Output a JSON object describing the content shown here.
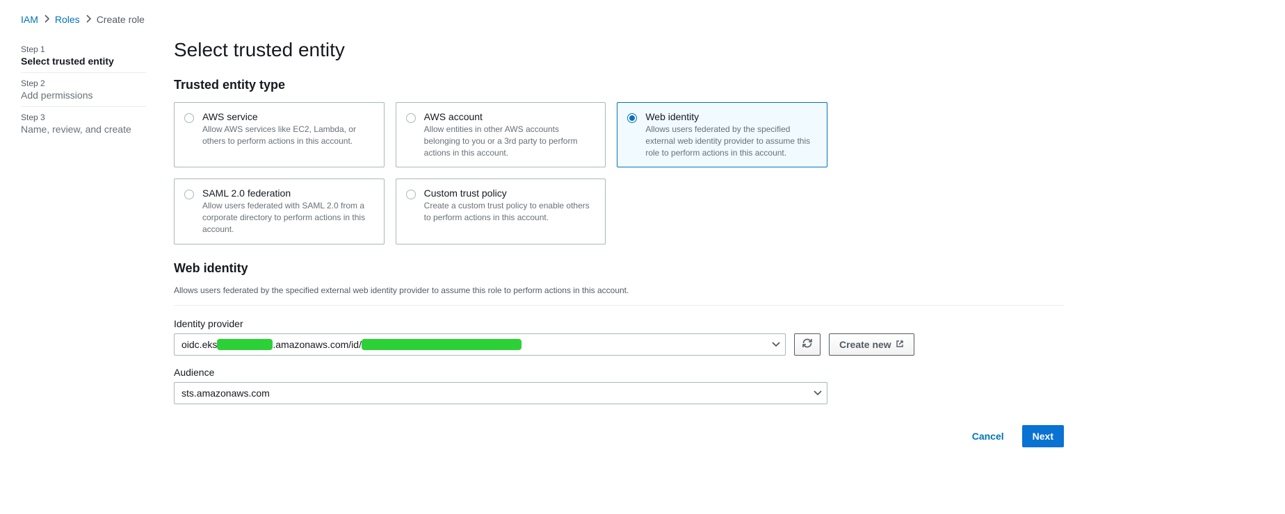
{
  "breadcrumb": {
    "iam": "IAM",
    "roles": "Roles",
    "current": "Create role"
  },
  "steps": [
    {
      "num": "Step 1",
      "title": "Select trusted entity"
    },
    {
      "num": "Step 2",
      "title": "Add permissions"
    },
    {
      "num": "Step 3",
      "title": "Name, review, and create"
    }
  ],
  "page_title": "Select trusted entity",
  "entity_type_heading": "Trusted entity type",
  "entity_options": [
    {
      "title": "AWS service",
      "desc": "Allow AWS services like EC2, Lambda, or others to perform actions in this account."
    },
    {
      "title": "AWS account",
      "desc": "Allow entities in other AWS accounts belonging to you or a 3rd party to perform actions in this account."
    },
    {
      "title": "Web identity",
      "desc": "Allows users federated by the specified external web identity provider to assume this role to perform actions in this account."
    },
    {
      "title": "SAML 2.0 federation",
      "desc": "Allow users federated with SAML 2.0 from a corporate directory to perform actions in this account."
    },
    {
      "title": "Custom trust policy",
      "desc": "Create a custom trust policy to enable others to perform actions in this account."
    }
  ],
  "web_identity": {
    "heading": "Web identity",
    "sub": "Allows users federated by the specified external web identity provider to assume this role to perform actions in this account.",
    "idp_label": "Identity provider",
    "idp_value_prefix": "oidc.eks",
    "idp_value_mid": ".amazonaws.com/id/",
    "audience_label": "Audience",
    "audience_value": "sts.amazonaws.com",
    "create_new": "Create new"
  },
  "footer": {
    "cancel": "Cancel",
    "next": "Next"
  }
}
